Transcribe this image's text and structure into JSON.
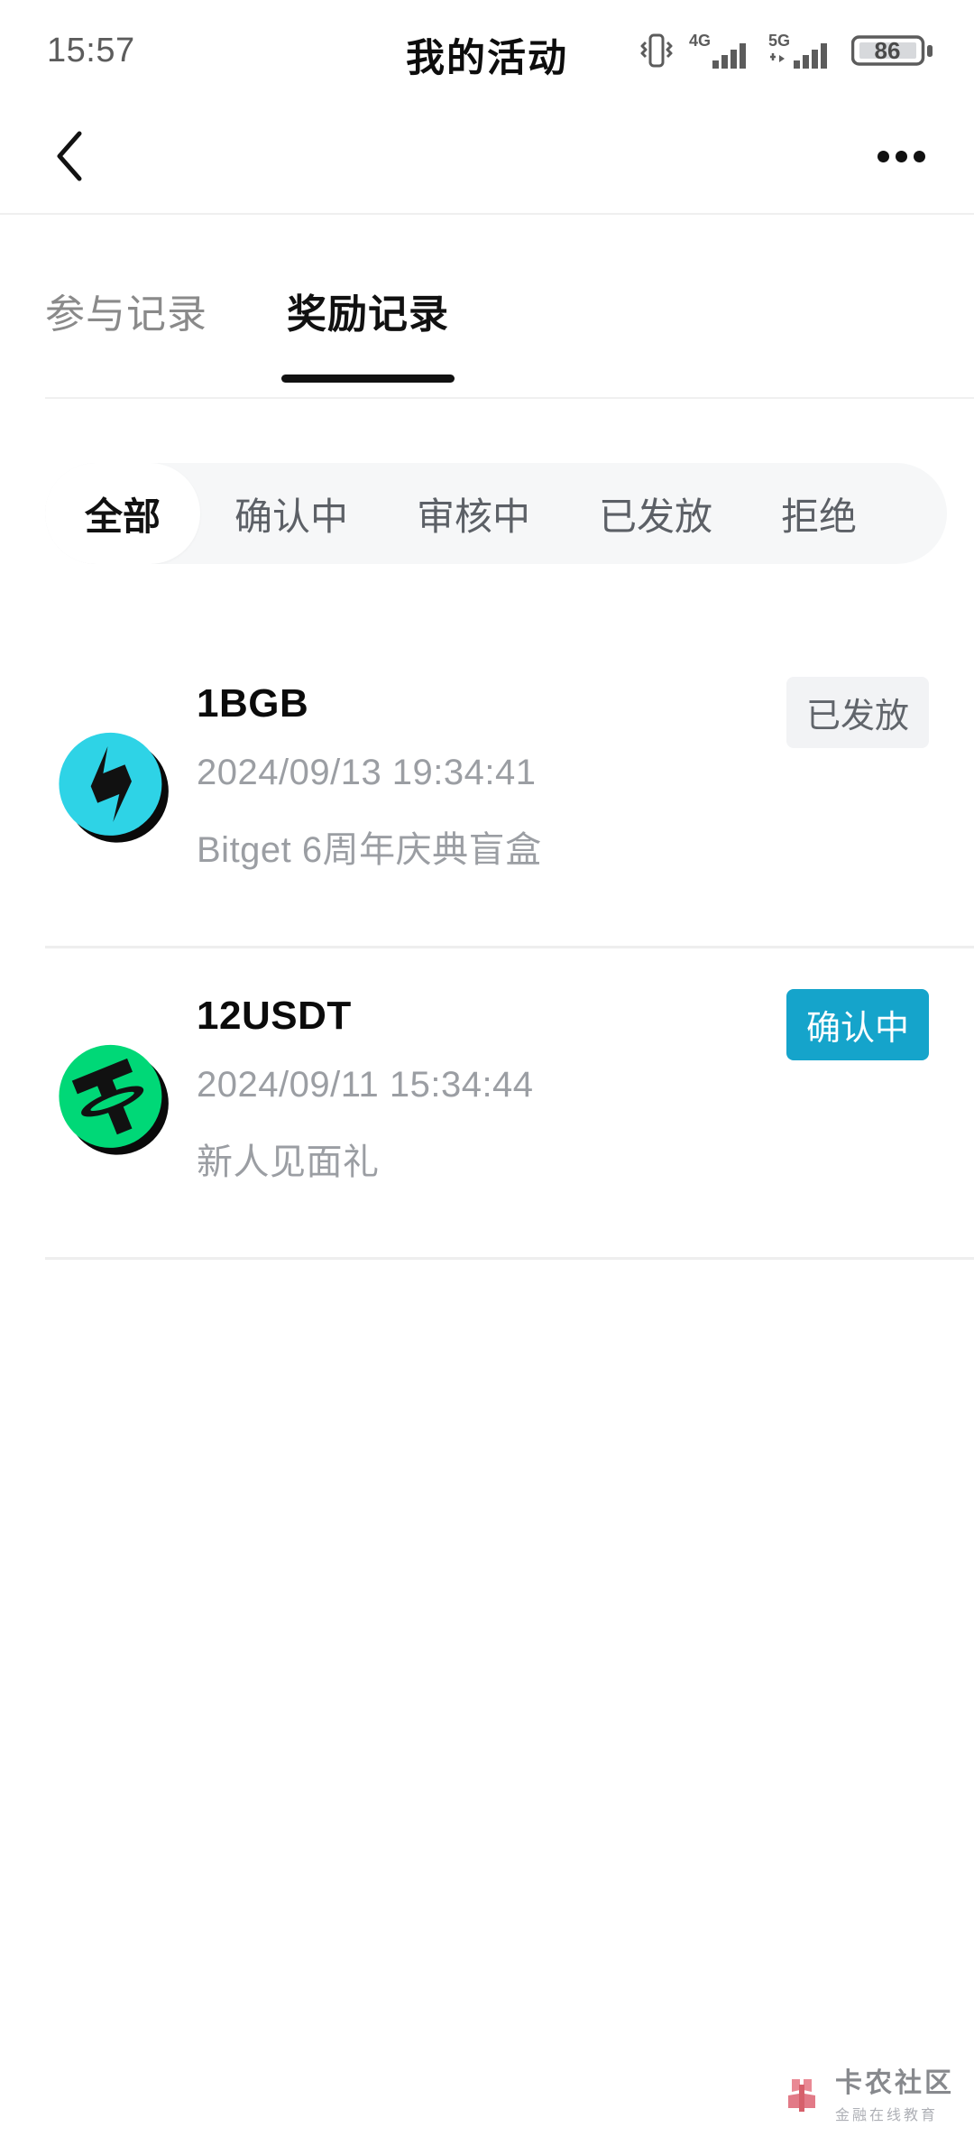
{
  "status_bar": {
    "time": "15:57",
    "battery_level": "86",
    "net1": "4G",
    "net2": "5G"
  },
  "header": {
    "title": "我的活动",
    "back_icon": "chevron-left-icon",
    "more_icon": "more-horizontal-icon"
  },
  "tabs": [
    {
      "label": "参与记录",
      "active": false
    },
    {
      "label": "奖励记录",
      "active": true
    }
  ],
  "filters": [
    {
      "label": "全部",
      "active": true
    },
    {
      "label": "确认中",
      "active": false
    },
    {
      "label": "审核中",
      "active": false
    },
    {
      "label": "已发放",
      "active": false
    },
    {
      "label": "拒绝",
      "active": false
    }
  ],
  "rewards": [
    {
      "amount": "1BGB",
      "date": "2024/09/13 19:34:41",
      "description": "Bitget 6周年庆典盲盒",
      "status": "已发放",
      "status_style": "grey",
      "coin": "bgb-coin-icon",
      "coin_color": "#2ed3e6"
    },
    {
      "amount": "12USDT",
      "date": "2024/09/11 15:34:44",
      "description": "新人见面礼",
      "status": "确认中",
      "status_style": "blue",
      "coin": "usdt-coin-icon",
      "coin_color": "#00d877"
    }
  ],
  "watermark": {
    "name": "卡农社区",
    "tagline": "金融在线教育",
    "logo_color": "#e8808c"
  },
  "colors": {
    "accent_blue": "#15a4cb",
    "badge_grey_bg": "#f2f3f5",
    "chip_track": "#f6f7f8",
    "muted_text": "#9b9ea3"
  }
}
